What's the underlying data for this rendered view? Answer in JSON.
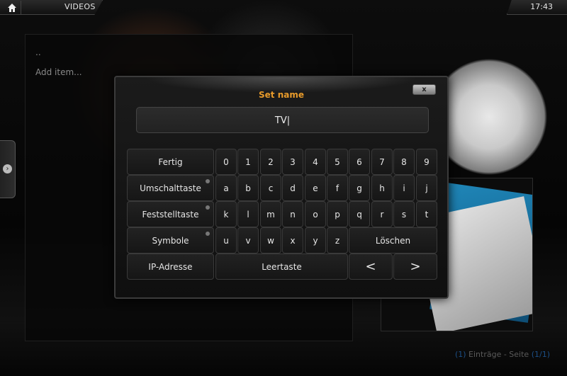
{
  "header": {
    "section": "VIDEOS",
    "time": "17:43"
  },
  "list": {
    "items": [
      "..",
      "Add item..."
    ]
  },
  "footer": {
    "count": "1",
    "entries_text": "Einträge - Seite",
    "page_current": "1",
    "page_total": "1"
  },
  "dialog": {
    "title": "Set name",
    "close_label": "x",
    "input_value": "TV|"
  },
  "keyboard": {
    "fertig": "Fertig",
    "umschalttaste": "Umschalttaste",
    "feststelltaste": "Feststelltaste",
    "symbole": "Symbole",
    "ip_adresse": "IP-Adresse",
    "leertaste": "Leertaste",
    "loeschen": "Löschen",
    "left_arrow": "<",
    "right_arrow": ">",
    "row1": [
      "0",
      "1",
      "2",
      "3",
      "4",
      "5",
      "6",
      "7",
      "8",
      "9"
    ],
    "row2": [
      "a",
      "b",
      "c",
      "d",
      "e",
      "f",
      "g",
      "h",
      "i",
      "j"
    ],
    "row3": [
      "k",
      "l",
      "m",
      "n",
      "o",
      "p",
      "q",
      "r",
      "s",
      "t"
    ],
    "row4": [
      "u",
      "v",
      "w",
      "x",
      "y",
      "z"
    ]
  },
  "icons": {
    "home": "home-icon",
    "side_tab": "chevron-right-icon"
  },
  "colors": {
    "title_accent": "#e89b2b",
    "footer_highlight": "#1c4f86"
  }
}
